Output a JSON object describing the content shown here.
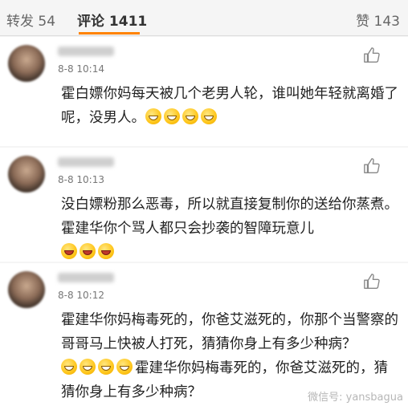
{
  "tabs": {
    "repost_label": "转发 54",
    "comments_label": "评论 1411",
    "likes_label": "赞 143"
  },
  "comments": [
    {
      "time": "8-8 10:14",
      "text": "霍白嫖你妈每天被几个老男人轮，谁叫她年轻就离婚了呢，没男人。",
      "emojis": [
        "grin",
        "grin",
        "grin",
        "grin"
      ]
    },
    {
      "time": "8-8 10:13",
      "text": "没白嫖粉那么恶毒，所以就直接复制你的送给你蒸煮。霍建华你个骂人都只会抄袭的智障玩意儿",
      "emojis": [
        "laugh",
        "laugh",
        "laugh"
      ]
    },
    {
      "time": "8-8 10:12",
      "text_a": "霍建华你妈梅毒死的，你爸艾滋死的，你那个当警察的哥哥马上快被人打死，猜猜你身上有多少种病？",
      "text_b": "霍建华你妈梅毒死的，你爸艾滋死的，猜猜你身上有多少种病？",
      "emojis": [
        "grin",
        "grin",
        "grin",
        "grin"
      ]
    }
  ],
  "watermark": "微信号: yansbagua",
  "icons": {
    "like": "thumbs-up-icon",
    "emoji": "grin-emoji-icon"
  },
  "colors": {
    "accent": "#ff8200",
    "background": "#f5f5f5"
  }
}
